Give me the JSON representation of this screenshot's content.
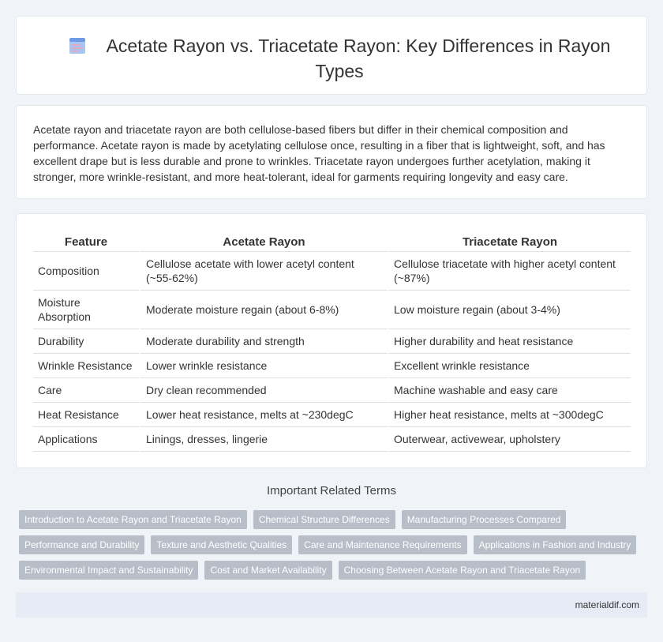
{
  "header": {
    "title": "Acetate Rayon vs. Triacetate Rayon: Key Differences in Rayon Types",
    "icon": "document-icon"
  },
  "intro": {
    "text": "Acetate rayon and triacetate rayon are both cellulose-based fibers but differ in their chemical composition and performance. Acetate rayon is made by acetylating cellulose once, resulting in a fiber that is lightweight, soft, and has excellent drape but is less durable and prone to wrinkles. Triacetate rayon undergoes further acetylation, making it stronger, more wrinkle-resistant, and more heat-tolerant, ideal for garments requiring longevity and easy care."
  },
  "table": {
    "headers": [
      "Feature",
      "Acetate Rayon",
      "Triacetate Rayon"
    ],
    "rows": [
      [
        "Composition",
        "Cellulose acetate with lower acetyl content (~55-62%)",
        "Cellulose triacetate with higher acetyl content (~87%)"
      ],
      [
        "Moisture Absorption",
        "Moderate moisture regain (about 6-8%)",
        "Low moisture regain (about 3-4%)"
      ],
      [
        "Durability",
        "Moderate durability and strength",
        "Higher durability and heat resistance"
      ],
      [
        "Wrinkle Resistance",
        "Lower wrinkle resistance",
        "Excellent wrinkle resistance"
      ],
      [
        "Care",
        "Dry clean recommended",
        "Machine washable and easy care"
      ],
      [
        "Heat Resistance",
        "Lower heat resistance, melts at ~230degC",
        "Higher heat resistance, melts at ~300degC"
      ],
      [
        "Applications",
        "Linings, dresses, lingerie",
        "Outerwear, activewear, upholstery"
      ]
    ]
  },
  "related": {
    "title": "Important Related Terms",
    "tags": [
      [
        "Introduction to Acetate Rayon and Triacetate Rayon",
        "Chemical Structure Differences",
        "Manufacturing Processes Compared"
      ],
      [
        "Performance and Durability",
        "Texture and Aesthetic Qualities",
        "Care and Maintenance Requirements",
        "Applications in Fashion and Industry"
      ],
      [
        "Environmental Impact and Sustainability",
        "Cost and Market Availability",
        "Choosing Between Acetate Rayon and Triacetate Rayon"
      ]
    ]
  },
  "footer": {
    "site": "materialdif.com"
  },
  "colors": {
    "background": "#f0f3f8",
    "tag": "#b8bec8",
    "footer": "#e6ebf5"
  }
}
